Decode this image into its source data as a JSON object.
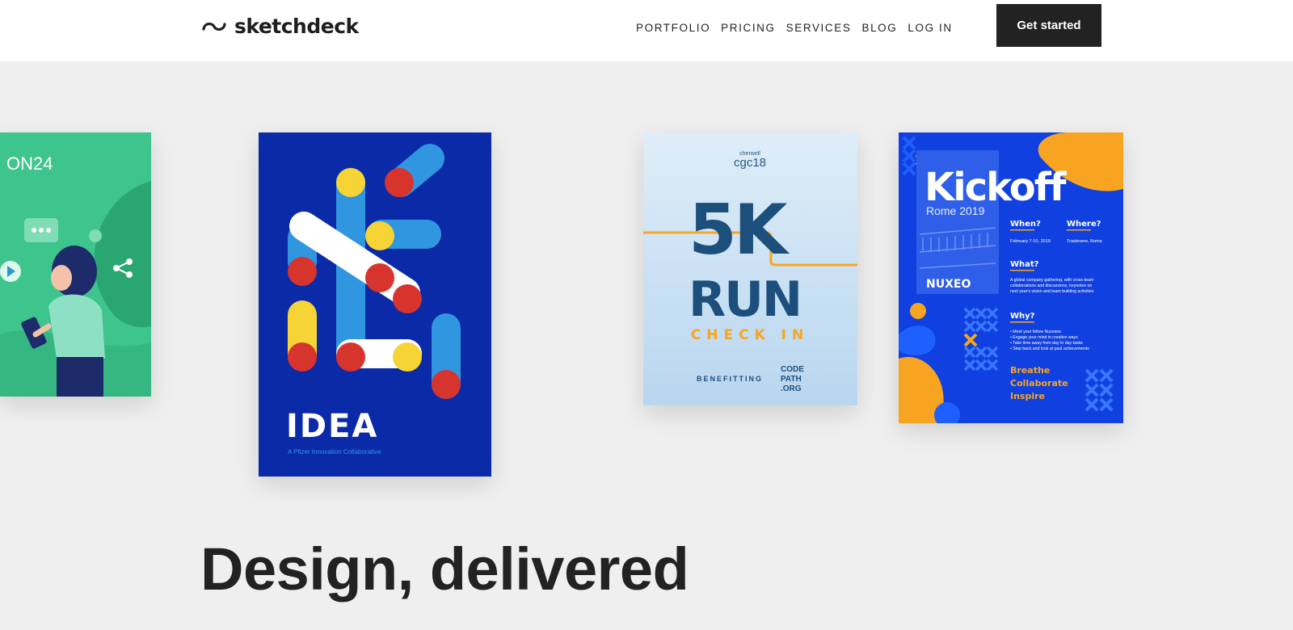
{
  "header": {
    "logo_text": "sketchdeck",
    "nav": [
      "PORTFOLIO",
      "PRICING",
      "SERVICES",
      "BLOG",
      "LOG IN"
    ],
    "cta_label": "Get started"
  },
  "cards": {
    "on24": {
      "brand": "ON24"
    },
    "idea": {
      "title": "IDEA",
      "tagline": "A Pfizer Innovation Collaborative"
    },
    "fivek": {
      "org": "cherwell",
      "event": "cgc18",
      "title": "5K",
      "subtitle": "RUN",
      "checkin": "CHECK IN",
      "benefit": "BENEFITTING",
      "charity_1": "CODE",
      "charity_2": "PATH",
      "charity_3": ".ORG"
    },
    "kickoff": {
      "title": "Kickoff",
      "subtitle": "Rome 2019",
      "when_label": "When?",
      "when_value": "February 7-10, 2019",
      "where_label": "Where?",
      "where_value": "Trastevere, Rome",
      "what_label": "What?",
      "what_line_1": "A global company gathering, with cross-team",
      "what_line_2": "collaborations and discussions, keynotes on",
      "what_line_3": "next year's vision and team building activities",
      "why_label": "Why?",
      "why_1": "• Meet your fellow Nuxeans",
      "why_2": "• Engage your mind in creative ways",
      "why_3": "• Take time away from day to day tasks",
      "why_4": "• Step back and look at past achievements",
      "tag_1": "Breathe",
      "tag_2": "Collaborate",
      "tag_3": "Inspire",
      "brand": "NUXEO"
    }
  },
  "hero": {
    "title": "Design, delivered"
  },
  "colors": {
    "header_bg": "#ffffff",
    "page_bg": "#efefef",
    "cta_bg": "#222222",
    "idea_bg": "#0a2aa8",
    "kickoff_bg": "#1140e0",
    "accent_orange": "#f7a521",
    "on24_green": "#3ec48d"
  }
}
